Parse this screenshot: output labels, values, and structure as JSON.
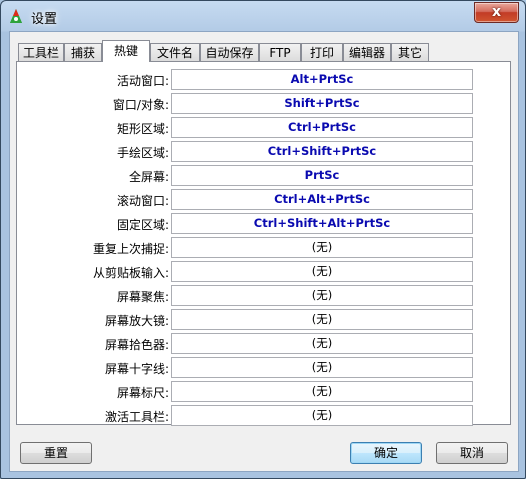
{
  "window": {
    "title": "设置",
    "close_glyph": "x"
  },
  "tabs": [
    {
      "label": "工具栏",
      "active": false
    },
    {
      "label": "捕获",
      "active": false
    },
    {
      "label": "热键",
      "active": true
    },
    {
      "label": "文件名",
      "active": false
    },
    {
      "label": "自动保存",
      "active": false
    },
    {
      "label": "FTP",
      "active": false
    },
    {
      "label": "打印",
      "active": false
    },
    {
      "label": "编辑器",
      "active": false
    },
    {
      "label": "其它",
      "active": false
    }
  ],
  "hotkeys": [
    {
      "label": "活动窗口:",
      "value": "Alt+PrtSc"
    },
    {
      "label": "窗口/对象:",
      "value": "Shift+PrtSc"
    },
    {
      "label": "矩形区域:",
      "value": "Ctrl+PrtSc"
    },
    {
      "label": "手绘区域:",
      "value": "Ctrl+Shift+PrtSc"
    },
    {
      "label": "全屏幕:",
      "value": "PrtSc"
    },
    {
      "label": "滚动窗口:",
      "value": "Ctrl+Alt+PrtSc"
    },
    {
      "label": "固定区域:",
      "value": "Ctrl+Shift+Alt+PrtSc"
    },
    {
      "label": "重复上次捕捉:",
      "value": "(无)"
    },
    {
      "label": "从剪贴板输入:",
      "value": "(无)"
    },
    {
      "label": "屏幕聚焦:",
      "value": "(无)"
    },
    {
      "label": "屏幕放大镜:",
      "value": "(无)"
    },
    {
      "label": "屏幕拾色器:",
      "value": "(无)"
    },
    {
      "label": "屏幕十字线:",
      "value": "(无)"
    },
    {
      "label": "屏幕标尺:",
      "value": "(无)"
    },
    {
      "label": "激活工具栏:",
      "value": "(无)"
    }
  ],
  "buttons": {
    "reset": "重置",
    "ok": "确定",
    "cancel": "取消"
  },
  "colors": {
    "hotkey_set": "#0a0ab0",
    "hotkey_none": "#000000",
    "close_button": "#c23b26"
  }
}
